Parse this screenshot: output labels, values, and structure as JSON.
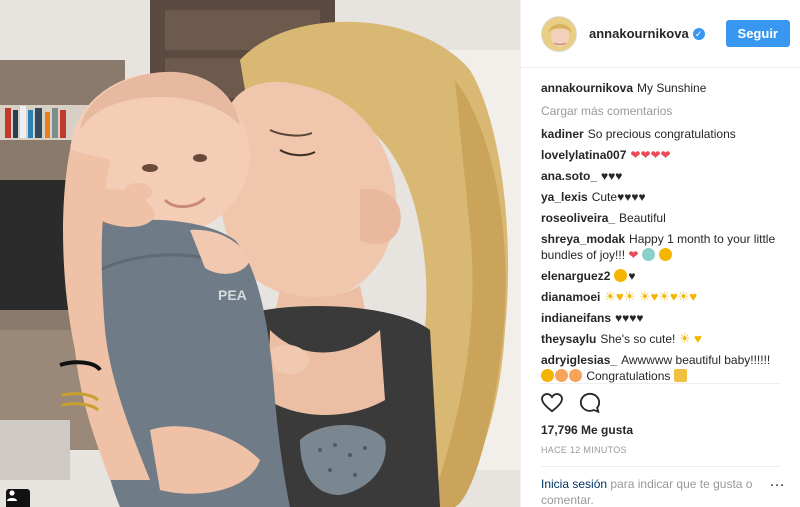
{
  "post": {
    "username": "annakournikova",
    "follow_label": "Seguir",
    "caption_user": "annakournikova",
    "caption_text": "My Sunshine",
    "load_more": "Cargar más comentarios",
    "likes": "17,796 Me gusta",
    "time": "HACE 12 MINUTOS",
    "login_link": "Inicia sesión",
    "login_text": " para indicar que te gusta o comentar.",
    "more_icon": "…"
  },
  "photo": {
    "sleeve_text": "PEA"
  },
  "comments": [
    {
      "user": "kadiner",
      "text": "So precious congratulations"
    },
    {
      "user": "lovelylatina007",
      "text": "",
      "glyphs": "❤❤❤❤"
    },
    {
      "user": "ana.soto_",
      "text": "",
      "glyphs": "♥♥♥"
    },
    {
      "user": "ya_lexis",
      "text": "Cute",
      "glyphs": "♥♥♥♥"
    },
    {
      "user": "roseoliveira_",
      "text": "Beautiful"
    },
    {
      "user": "shreya_modak",
      "text": "Happy 1 month to your little bundles of joy!!!",
      "glyphs": "❤"
    },
    {
      "user": "elenarguez2",
      "text": "",
      "glyphs": "♥"
    },
    {
      "user": "dianamoei",
      "text": "",
      "glyphs": "☀♥☀ ☀♥☀♥☀♥"
    },
    {
      "user": "indianeifans",
      "text": "",
      "glyphs": "♥♥♥♥"
    },
    {
      "user": "theysaylu",
      "text": "She's so cute!",
      "glyphs": "☀ ♥"
    },
    {
      "user": "adryiglesias_",
      "text": "Awwwww beautiful baby!!!!!!",
      "text2": "Congratulations"
    }
  ],
  "icons": {
    "avatar": "avatar-image",
    "verified": "verified-badge-icon",
    "like": "heart-outline-icon",
    "comment": "comment-bubble-icon",
    "more": "more-options-icon",
    "corner": "user-profile-icon"
  },
  "colors": {
    "accent": "#3897f0",
    "link": "#003569",
    "muted": "#999999",
    "heart": "#ed4956"
  }
}
